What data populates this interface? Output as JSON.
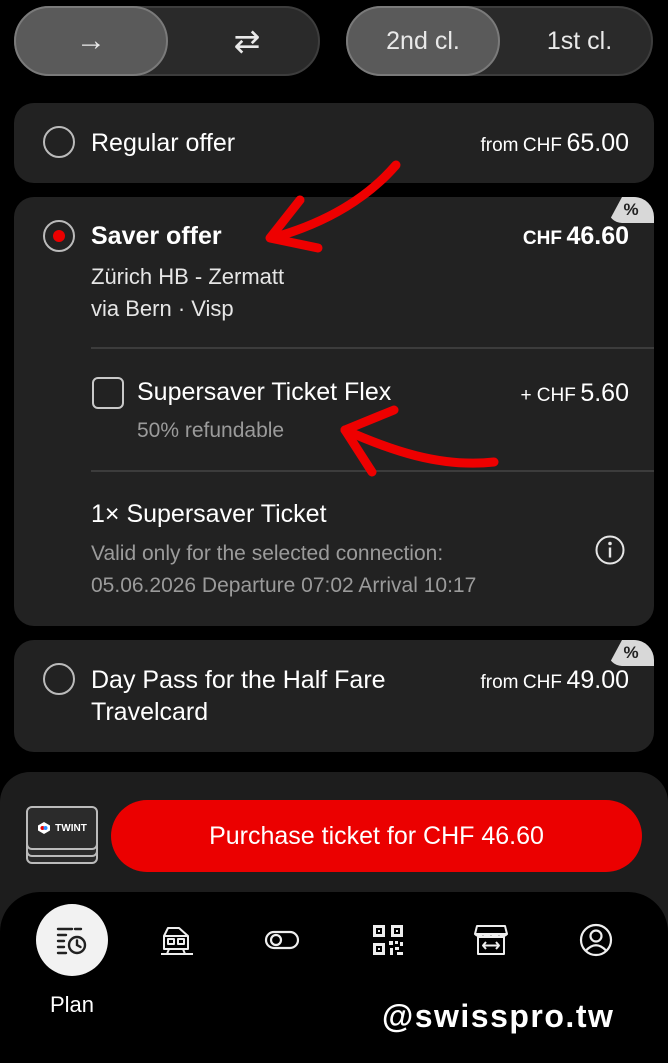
{
  "segment": {
    "direction_oneway": "→",
    "direction_return": "⇄",
    "class_2nd": "2nd cl.",
    "class_1st": "1st cl."
  },
  "offers": {
    "regular": {
      "label": "Regular offer",
      "from": "from",
      "currency": "CHF",
      "price": "65.00"
    },
    "saver": {
      "label": "Saver offer",
      "currency": "CHF",
      "price": "46.60",
      "route": "Zürich HB - Zermatt",
      "via": "via Bern · Visp",
      "badge": "%",
      "addon": {
        "label": "Supersaver Ticket Flex",
        "sub": "50% refundable",
        "price_prefix": "+ CHF",
        "price": "5.60"
      },
      "ticket": {
        "title": "1× Supersaver Ticket",
        "line1": "Valid only for the selected connection:",
        "line2": "05.06.2026 Departure 07:02 Arrival 10:17"
      }
    },
    "daypass": {
      "label_line1": "Day Pass for the Half Fare",
      "label_line2": "Travelcard",
      "from": "from",
      "currency": "CHF",
      "price": "49.00",
      "badge": "%"
    }
  },
  "payment": {
    "twint_label": "TWINT",
    "purchase_label": "Purchase ticket for CHF 46.60"
  },
  "tabs": {
    "plan_label": "Plan"
  },
  "watermark": "@swisspro.tw",
  "colors": {
    "accent": "#eb0000",
    "background": "#000000",
    "card": "#222222"
  }
}
